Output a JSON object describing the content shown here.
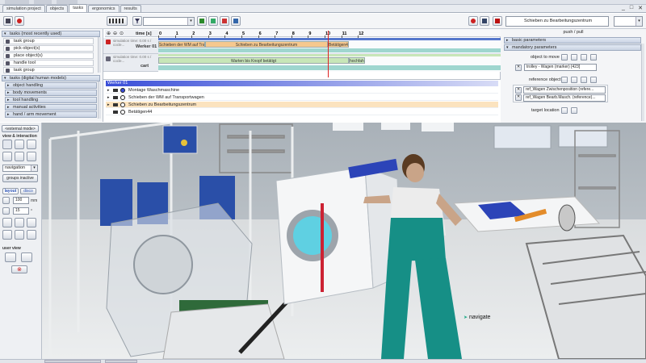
{
  "tabs": [
    {
      "label": "simulation project"
    },
    {
      "label": "objects"
    },
    {
      "label": "tasks"
    },
    {
      "label": "ergonomics"
    },
    {
      "label": "results"
    }
  ],
  "toolbar": {
    "combo_value": "",
    "object_field": "Schieben zu Bearbeitungszentrum",
    "push_pull": "push / pull"
  },
  "left_groups": [
    {
      "label": "tasks (most recently used)"
    },
    {
      "label": "tasks (digital human models)"
    }
  ],
  "recent_tasks": [
    {
      "label": "task group"
    },
    {
      "label": "pick object(s)"
    },
    {
      "label": "place object(s)"
    },
    {
      "label": "handle tool"
    },
    {
      "label": "task group"
    }
  ],
  "dhm_groups": [
    {
      "label": "object handling"
    },
    {
      "label": "body movements"
    },
    {
      "label": "tool handling"
    },
    {
      "label": "manual activities"
    },
    {
      "label": "hand / arm movement"
    }
  ],
  "timeline": {
    "time_label": "time [s]",
    "ticks": [
      "0",
      "1",
      "2",
      "3",
      "4",
      "5",
      "6",
      "7",
      "8",
      "9",
      "10",
      "11",
      "12"
    ],
    "rows": [
      {
        "name": "Werker 01",
        "sim_time": "simulation time: 0.00 s / cocle..."
      },
      {
        "name": "cart",
        "sim_time": "simulation time: 0.00 s / cocle..."
      }
    ],
    "tasks_row1": [
      {
        "label": "Schieben der WM auf Tran"
      },
      {
        "label": "Schieben zu Bearbeitungszentrum"
      },
      {
        "label": "Betätigen4"
      }
    ],
    "tasks_row2": [
      {
        "label": "Warten bis Knopf betätigt"
      },
      {
        "label": "hochfahr"
      }
    ]
  },
  "task_list": {
    "header": "Werker 01",
    "rows": [
      {
        "label": "Montage Waschmaschine"
      },
      {
        "label": "Schieben der WM auf Transportwagen"
      },
      {
        "label": "Schieben zu Bearbeitungszentrum"
      },
      {
        "label": "Betätigen44"
      }
    ]
  },
  "properties": {
    "sections": [
      {
        "label": "basic parameters"
      },
      {
        "label": "mandatory parameters"
      }
    ],
    "object_to_move_label": "object to move",
    "object_to_move_value": "trolley - Wagen (marker) [423]",
    "reference_object_label": "reference object",
    "ref_values": [
      "ref_Wagen Zwischenposition (refere...",
      "ref_Wagen Bearb.Masch. (reference)..."
    ],
    "target_location_label": "target location"
  },
  "sidebar": {
    "external_mode": "<external mode>",
    "view_interaction": "view & interaction",
    "navigation_value": "navigation",
    "groups_inactive": "groups inactive",
    "layout_tab": "layout",
    "disco_tab": "disco",
    "value_1": "100",
    "unit_1": "mm",
    "value_2": "15",
    "unit_2": "°",
    "user_view": "user view"
  },
  "viewport": {
    "nav_label": "navigate"
  },
  "colors": {
    "accent_blue": "#3a4ed8",
    "task_orange": "#f6c88e",
    "task_teal": "#9fd6cf",
    "task_green": "#c8e6b8",
    "overall_blue": "#5577cc"
  }
}
